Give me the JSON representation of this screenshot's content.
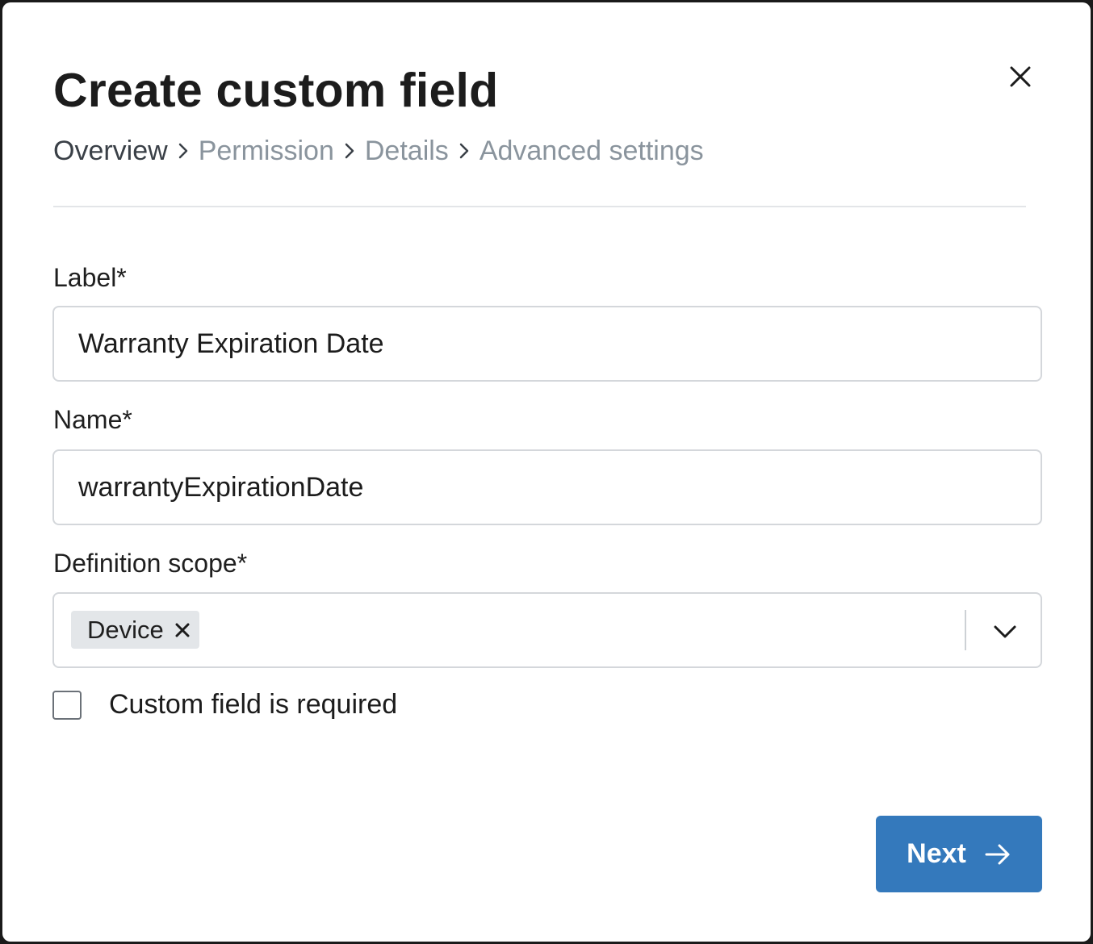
{
  "modal": {
    "title": "Create custom field",
    "close_icon": "close-icon"
  },
  "breadcrumb": {
    "steps": [
      "Overview",
      "Permission",
      "Details",
      "Advanced settings"
    ],
    "active_index": 0,
    "separator_icon": "chevron-right-icon"
  },
  "form": {
    "label": {
      "label": "Label*",
      "value": "Warranty Expiration Date"
    },
    "name": {
      "label": "Name*",
      "value": "warrantyExpirationDate"
    },
    "scope": {
      "label": "Definition scope*",
      "selected": [
        "Device"
      ],
      "remove_icon": "x-icon",
      "dropdown_icon": "chevron-down-icon"
    },
    "required": {
      "label": "Custom field is required",
      "checked": false
    }
  },
  "footer": {
    "next_label": "Next",
    "next_icon": "arrow-right-icon"
  },
  "colors": {
    "primary": "#3479bc",
    "text": "#1c1c1c",
    "muted": "#8a949d",
    "border": "#d4d7db",
    "tag_bg": "#e3e6e9"
  }
}
